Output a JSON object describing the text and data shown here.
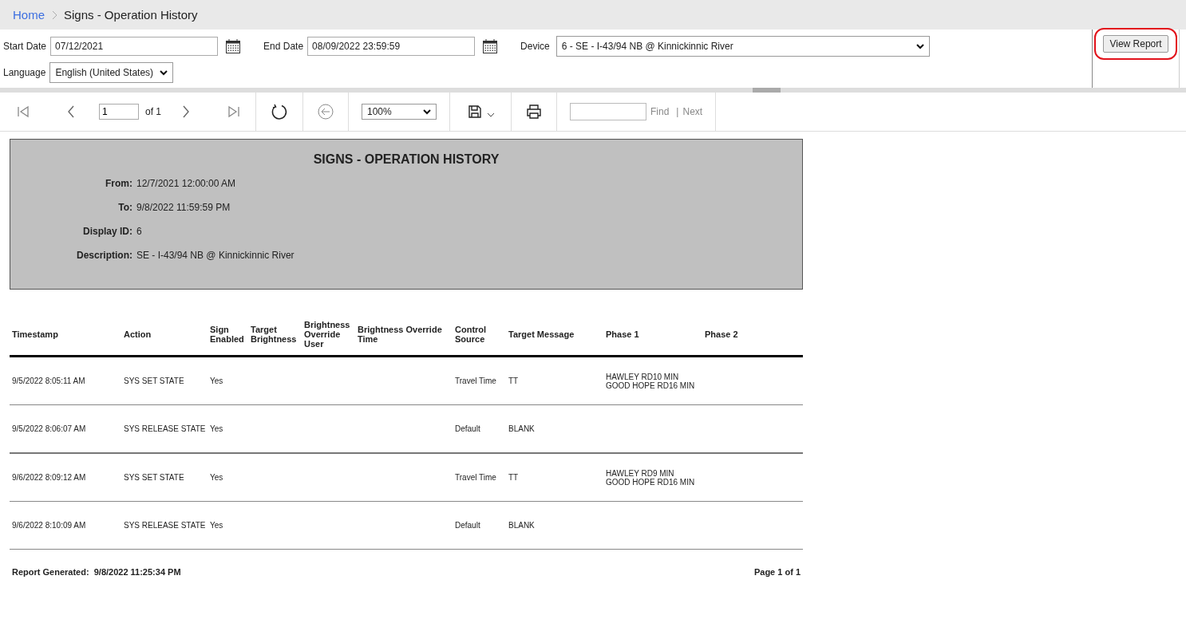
{
  "breadcrumb": {
    "home": "Home",
    "current": "Signs - Operation History"
  },
  "parameters": {
    "start_date": {
      "label": "Start Date",
      "value": "07/12/2021"
    },
    "end_date": {
      "label": "End Date",
      "value": "08/09/2022 23:59:59"
    },
    "device": {
      "label": "Device",
      "value": "6 - SE - I-43/94 NB @ Kinnickinnic River"
    },
    "language": {
      "label": "Language",
      "value": "English (United States)"
    }
  },
  "view_report_button": {
    "label": "View Report",
    "highlighted": true
  },
  "toolbar": {
    "page": "1",
    "of": "of 1",
    "zoom": "100%",
    "find": "Find",
    "separator": "|",
    "next": "Next"
  },
  "report": {
    "title": "SIGNS - OPERATION HISTORY",
    "fields": [
      {
        "label": "From:",
        "value": "12/7/2021 12:00:00 AM"
      },
      {
        "label": "To:",
        "value": "9/8/2022 11:59:59 PM"
      },
      {
        "label": "Display ID:",
        "value": "6"
      },
      {
        "label": "Description:",
        "value": "SE - I-43/94 NB @ Kinnickinnic River"
      }
    ],
    "table": {
      "columns": [
        "Timestamp",
        "Action",
        "Sign Enabled",
        "Target Brightness",
        "Brightness Override User",
        "Brightness Override Time",
        "Control Source",
        "Target Message",
        "Phase 1",
        "Phase 2"
      ],
      "rows": [
        [
          "9/5/2022 8:05:11 AM",
          "SYS SET STATE",
          "Yes",
          "",
          "",
          "",
          "Travel Time",
          "TT",
          "HAWLEY RD10 MIN\nGOOD HOPE RD16 MIN",
          ""
        ],
        [
          "9/5/2022 8:06:07 AM",
          "SYS RELEASE STATE",
          "Yes",
          "",
          "",
          "",
          "Default",
          "BLANK",
          "",
          ""
        ],
        [
          "9/6/2022 8:09:12 AM",
          "SYS SET STATE",
          "Yes",
          "",
          "",
          "",
          "Travel Time",
          "TT",
          "HAWLEY RD9 MIN\nGOOD HOPE RD16 MIN",
          ""
        ],
        [
          "9/6/2022 8:10:09 AM",
          "SYS RELEASE STATE",
          "Yes",
          "",
          "",
          "",
          "Default",
          "BLANK",
          "",
          ""
        ]
      ]
    },
    "footer": {
      "generated_label": "Report Generated:",
      "generated_value": "9/8/2022 11:25:34 PM",
      "page": "Page 1 of 1"
    }
  }
}
